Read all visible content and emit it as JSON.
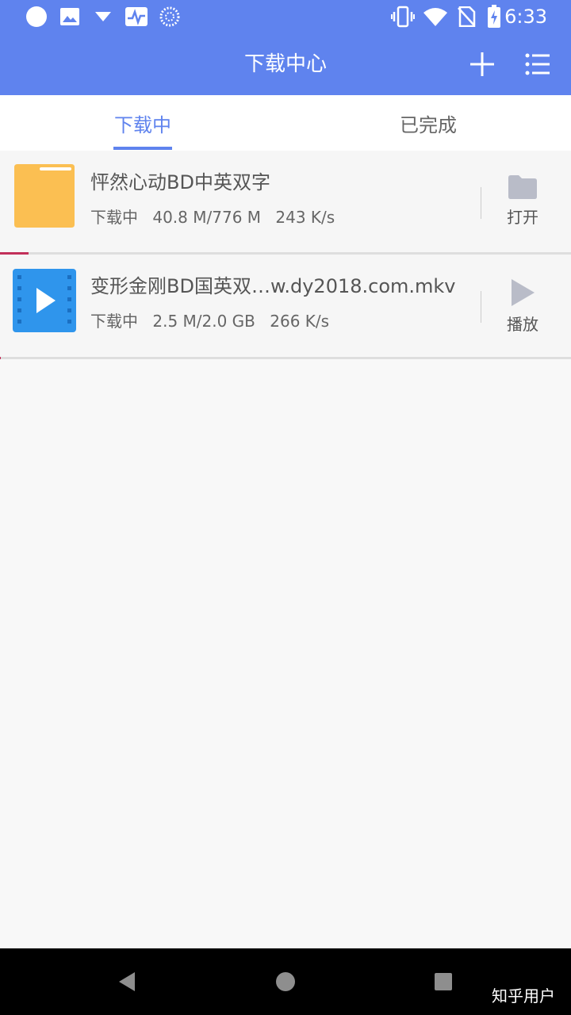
{
  "status_bar": {
    "time": "6:33",
    "left_icons": [
      "circle-icon",
      "image-icon",
      "download-arrow-icon",
      "activity-icon",
      "sync-icon"
    ],
    "right_icons": [
      "vibrate-icon",
      "wifi-icon",
      "no-sim-icon",
      "battery-charging-icon"
    ]
  },
  "app_bar": {
    "title": "下载中心",
    "actions": [
      "add-icon",
      "list-menu-icon"
    ],
    "color": "#5f83ee"
  },
  "tabs": [
    {
      "label": "下载中",
      "active": true
    },
    {
      "label": "已完成",
      "active": false
    }
  ],
  "downloads": [
    {
      "title": "怦然心动BD中英双字",
      "status": "下载中",
      "size": "40.8 M/776 M",
      "speed": "243 K/s",
      "progress": 0.05,
      "icon": "folder-icon",
      "action_label": "打开",
      "action_icon": "folder-open-icon"
    },
    {
      "title": "变形金刚BD国英双…w.dy2018.com.mkv",
      "status": "下载中",
      "size": "2.5 M/2.0 GB",
      "speed": "266 K/s",
      "progress": 0.001,
      "icon": "video-file-icon",
      "action_label": "播放",
      "action_icon": "play-icon"
    }
  ],
  "nav_bar": {
    "buttons": [
      "back-icon",
      "home-icon",
      "recents-icon"
    ]
  },
  "watermark": "知乎用户",
  "colors": {
    "accent": "#5f83ee",
    "progress": "#c2305a",
    "folder": "#fbbf52",
    "video": "#2f95ec"
  }
}
